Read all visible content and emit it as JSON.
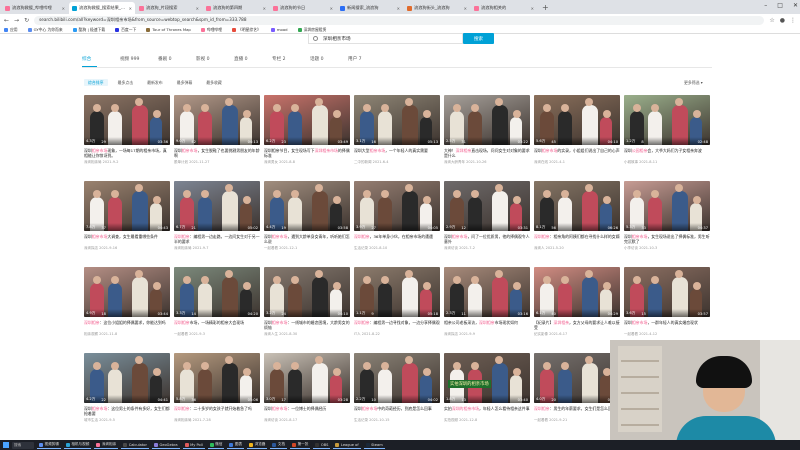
{
  "browser": {
    "tabs": [
      {
        "label": "流浪狗救援_哔哩哔哩",
        "color": "#fb7299",
        "active": false
      },
      {
        "label": "流浪狗救援_搜索结果_哔哩哔哩",
        "color": "#00a1d6",
        "active": true
      },
      {
        "label": "流浪狗_片段搜索",
        "color": "#fb7299",
        "active": false
      },
      {
        "label": "流浪狗的第四期",
        "color": "#fb7299",
        "active": false
      },
      {
        "label": "流浪狗的节日",
        "color": "#fb7299",
        "active": false
      },
      {
        "label": "新闻搜索_流浪狗",
        "color": "#2b6ef5",
        "active": false
      },
      {
        "label": "流浪狗街头_流浪狗",
        "color": "#e06b2d",
        "active": false
      },
      {
        "label": "流浪狗相关的",
        "color": "#fb7299",
        "active": false
      }
    ],
    "url": "search.bilibili.com/all?keyword=深圳相亲市场&from_source=webtop_search&spm_id_from=333.788",
    "bookmarks": [
      {
        "label": "应用",
        "color": "#4285f4"
      },
      {
        "label": "GY中心 为你而来",
        "color": "#5b8def"
      },
      {
        "label": "酷狗 | 极速下载",
        "color": "#2b9bf4"
      },
      {
        "label": "百度一下",
        "color": "#2932e1"
      },
      {
        "label": "Tour of Thrones Map",
        "color": "#8a6d3b"
      },
      {
        "label": "哔哩哔哩",
        "color": "#fb7299"
      },
      {
        "label": "《明星综艺》",
        "color": "#e74c3c"
      },
      {
        "label": "mood",
        "color": "#7a5cff"
      },
      {
        "label": "深圳房屋租赁",
        "color": "#34a853"
      }
    ]
  },
  "search": {
    "query": "深圳相亲市场",
    "button": "搜索"
  },
  "categories": [
    {
      "label": "综合",
      "active": true
    },
    {
      "label": "视频 999",
      "active": false
    },
    {
      "label": "番剧 0",
      "active": false
    },
    {
      "label": "影视 0",
      "active": false
    },
    {
      "label": "直播 0",
      "active": false
    },
    {
      "label": "专栏 2",
      "active": false
    },
    {
      "label": "话题 0",
      "active": false
    },
    {
      "label": "用户 7",
      "active": false
    }
  ],
  "filters": [
    {
      "label": "综合排序",
      "active": true
    },
    {
      "label": "最多点击",
      "active": false
    },
    {
      "label": "最新发布",
      "active": false
    },
    {
      "label": "最多弹幕",
      "active": false
    },
    {
      "label": "最多收藏",
      "active": false
    }
  ],
  "all_filters": "更多筛选",
  "videos": [
    {
      "plays": "4.3万",
      "danmaku": "29",
      "duration": "03:36",
      "title_pre": "深圳",
      "title_hl": "相亲市场",
      "title_post": "现象，一场每17期的相亲市场，真相能让你惊讶到。",
      "author": "深圳相亲局",
      "date": "2021-9-2",
      "bg": "#8c7464"
    },
    {
      "plays": "9.0万",
      "danmaku": "42",
      "duration": "04:13",
      "title_pre": "深圳",
      "title_hl": "相亲市场",
      "title_post": "，女生脱鞋了也要挑剔男朋友的年龄啊",
      "author": "脱单计划",
      "date": "2021-11-27",
      "bg": "#b49a8a"
    },
    {
      "plays": "6.2万",
      "danmaku": "23",
      "duration": "03:49",
      "title_pre": "深圳相亲节目，女生现场写下",
      "title_hl": "深圳相亲市场",
      "title_post": "的择偶标准",
      "author": "深圳男女",
      "date": "2021-8-8",
      "bg": "#c9736b"
    },
    {
      "plays": "3.1万",
      "danmaku": "16",
      "duration": "05:13",
      "title_pre": "深圳大型",
      "title_hl": "相亲市场",
      "title_post": "，一个年轻人的真实需要",
      "author": "二中的新闻",
      "date": "2021-6-4",
      "bg": "#8f8676"
    },
    {
      "plays": "2.5万",
      "danmaku": "31",
      "duration": "03:22",
      "title_pre": "大神！",
      "title_hl": "深圳相亲",
      "title_post": "直击现场，问问女生对对象的要求是什么",
      "author": "深圳大龄青年",
      "date": "2021-10-26",
      "bg": "#a7a19b"
    },
    {
      "plays": "5.6万",
      "danmaku": "45",
      "duration": "04:10",
      "title_pre": "深圳",
      "title_hl": "相亲市场",
      "title_post": "的实录，小姐姐们说出了自己的心声",
      "author": "深圳在线",
      "date": "2021-4-1",
      "bg": "#8a6f5b"
    },
    {
      "plays": "1.2万",
      "danmaku": "8",
      "duration": "02:48",
      "title_pre": "深圳",
      "title_hl": "公园相亲",
      "title_post": "会，大爷大妈们为子女相亲奔波",
      "author": "小城故事",
      "date": "2021-8-11",
      "bg": "#9bb08c"
    },
    {
      "plays": "7.8万",
      "danmaku": "37",
      "duration": "04:43",
      "title_pre": "深圳",
      "title_hl": "相亲市场",
      "title_post": "大调查，女生最看重哪些条件",
      "author": "深圳探店",
      "date": "2021-9-16",
      "bg": "#9a826f"
    },
    {
      "plays": "6.7万",
      "danmaku": "21",
      "duration": "05:02",
      "title_pre": "",
      "title_hl": "深圳相亲",
      "title_post": "：编程男一边走路，一边问女生对于另一半的要求",
      "author": "深圳相亲局",
      "date": "2021-9-7",
      "bg": "#7d8593"
    },
    {
      "plays": "4.4万",
      "danmaku": "19",
      "duration": "03:58",
      "title_pre": "深圳",
      "title_hl": "相亲市场",
      "title_post": "，遇到大龄单身女青年，听听她们怎么说",
      "author": "一起看看",
      "date": "2021-12-1",
      "bg": "#a18e7f"
    },
    {
      "plays": "3.9万",
      "danmaku": "27",
      "duration": "04:05",
      "title_pre": "",
      "title_hl": "深圳相亲",
      "title_post": "，36年单身小伙，在相亲市场的遭遇",
      "author": "生活记录",
      "date": "2021-8-10",
      "bg": "#957e72"
    },
    {
      "plays": "2.9万",
      "danmaku": "12",
      "duration": "03:31",
      "title_pre": "深圳",
      "title_hl": "相亲市场",
      "title_post": "，问了一位优质男，他的择偶观令人意外",
      "author": "深圳访谈",
      "date": "2021-7-2",
      "bg": "#6e6a6a"
    },
    {
      "plays": "8.1万",
      "danmaku": "56",
      "duration": "06:26",
      "title_pre": "",
      "title_hl": "深圳相亲",
      "title_post": "：相亲角的阿姨们都在寻找什么样的女婿",
      "author": "深圳人",
      "date": "2021-5-20",
      "bg": "#857565"
    },
    {
      "plays": "5.3万",
      "danmaku": "33",
      "duration": "04:37",
      "title_pre": "深圳",
      "title_hl": "相亲市场",
      "title_post": "，女生现场说出了择偶标准，男生听完沉默了",
      "author": "小李访谈",
      "date": "2021-10-3",
      "bg": "#c79c94"
    },
    {
      "plays": "4.9万",
      "danmaku": "18",
      "duration": "03:44",
      "title_pre": "",
      "title_hl": "深圳相亲",
      "title_post": "：这位小姐姐的择偶要求，你能达到吗",
      "author": "相亲观察",
      "date": "2021-11-8",
      "bg": "#b58f85"
    },
    {
      "plays": "3.3万",
      "danmaku": "14",
      "duration": "04:20",
      "title_pre": "",
      "title_hl": "深圳相亲",
      "title_post": "市场，一场精彩的相亲大会现场",
      "author": "一起看看",
      "date": "2021-9-3",
      "bg": "#7c8a7c"
    },
    {
      "plays": "3.2万",
      "danmaku": "24",
      "duration": "04:10",
      "title_pre": "深圳",
      "title_hl": "相亲市场",
      "title_post": "：一线城市的婚恋困境，大龄男女的烦恼",
      "author": "深圳人生",
      "date": "2021-8-30",
      "bg": "#867a70"
    },
    {
      "plays": "1.1万",
      "danmaku": "9",
      "duration": "05:18",
      "title_pre": "",
      "title_hl": "深圳相亲",
      "title_post": "：编程男一边寻找对象，一边分享择偶观",
      "author": "IT人",
      "date": "2021-8-22",
      "bg": "#8d7c6d"
    },
    {
      "plays": "2.3万",
      "danmaku": "11",
      "duration": "03:16",
      "title_pre": "相亲公司老板采访，",
      "title_hl": "深圳相亲",
      "title_post": "市场现状如何",
      "author": "深圳探店",
      "date": "2021-9-9",
      "bg": "#a88b7b"
    },
    {
      "plays": "6.1万",
      "danmaku": "40",
      "duration": "04:29",
      "title_pre": "【纪录片】",
      "title_hl": "深圳相亲",
      "title_post": "，女方父母的要求让人难以接受",
      "author": "纪实影像",
      "date": "2021-6-17",
      "bg": "#d28d83"
    },
    {
      "plays": "3.6万",
      "danmaku": "15",
      "duration": "03:57",
      "title_pre": "深圳",
      "title_hl": "相亲市场",
      "title_post": "，一群年轻人的真实婚恋现状",
      "author": "一起看看",
      "date": "2021-4-12",
      "bg": "#8c6f62"
    },
    {
      "plays": "4.2万",
      "danmaku": "22",
      "duration": "04:41",
      "title_pre": "深圳",
      "title_hl": "相亲市场",
      "title_post": "：这位男士的条件有多好，女生们都抢着要",
      "author": "城市生活",
      "date": "2021-9-5",
      "bg": "#7a8f9b"
    },
    {
      "plays": "5.8万",
      "danmaku": "36",
      "duration": "05:06",
      "title_pre": "",
      "title_hl": "深圳相亲",
      "title_post": "：二十多岁的女孩子就开始着急了吗",
      "author": "深圳相亲局",
      "date": "2021-7-28",
      "bg": "#b59a7f"
    },
    {
      "plays": "3.0万",
      "danmaku": "17",
      "duration": "03:28",
      "title_pre": "深圳",
      "title_hl": "相亲市场",
      "title_post": "：一位博士的择偶经历",
      "author": "深圳访谈",
      "date": "2021-8-17",
      "bg": "#c9c1b6"
    },
    {
      "plays": "2.2万",
      "danmaku": "10",
      "duration": "04:02",
      "title_pre": "深圳",
      "title_hl": "相亲市场",
      "title_post": "中的奇葩经历，到底是怎么回事",
      "author": "生活记录",
      "date": "2021-10-15",
      "bg": "#8b8377"
    },
    {
      "plays": "1.8万",
      "danmaku": "13",
      "duration": "03:40",
      "title_pre": "实拍",
      "title_hl": "深圳的相亲市场",
      "title_post": "，年轻人怎么看待相亲这件事",
      "author": "实拍视频",
      "date": "2021-12-8",
      "bg": "#6d5e54",
      "caption": "实拍深圳的相亲市场"
    },
    {
      "plays": "4.0万",
      "danmaku": "20",
      "duration": "04:30",
      "title_pre": "",
      "title_hl": "深圳相亲",
      "title_post": "：男生的年薪要求，女生们是怎么回答的",
      "author": "一起看看",
      "date": "2021-9-21",
      "bg": "#75706d"
    },
    {
      "plays": "5.0万",
      "danmaku": "29",
      "duration": "04:18",
      "title_pre": "深圳",
      "title_hl": "相亲市场",
      "title_post": "直击：择偶标准越来越高了吗",
      "author": "深圳在线",
      "date": "2021-11-2",
      "bg": "#99867a"
    },
    {
      "plays": "3.4万",
      "danmaku": "19",
      "duration": "03:52",
      "title_pre": "",
      "title_hl": "深圳相亲",
      "title_post": "：这位阿姨为了给女儿找对象操碎了心",
      "author": "城市记录",
      "date": "2021-8-28",
      "bg": "#a08a7e"
    },
    {
      "plays": "2.6万",
      "danmaku": "16",
      "duration": "04:08",
      "title_pre": "深圳",
      "title_hl": "相亲市场",
      "title_post": "，女方父母的要求，男生们怎么看",
      "author": "深圳人生",
      "date": "2021-9-12",
      "bg": "#7f7b86"
    }
  ],
  "taskbar": {
    "search_label": "搜索",
    "apps": [
      {
        "label": "视频剪辑",
        "color": "#5b8def"
      },
      {
        "label": "相机与视频",
        "color": "#29a3d6"
      },
      {
        "label": "深圳相亲",
        "color": "#fb7299"
      },
      {
        "label": "Calculator",
        "color": "#4a4a4a"
      },
      {
        "label": "GeoGebra",
        "color": "#8a7dd8"
      },
      {
        "label": "My Poll",
        "color": "#e05b5b"
      },
      {
        "label": "微信",
        "color": "#2ebd5c"
      },
      {
        "label": "图表",
        "color": "#3c78d8"
      },
      {
        "label": "浏览器",
        "color": "#f0b41c"
      },
      {
        "label": "文档",
        "color": "#2b579a"
      },
      {
        "label": "第一张",
        "color": "#d24726"
      },
      {
        "label": "OBS",
        "color": "#333"
      },
      {
        "label": "League of",
        "color": "#c89b3c"
      },
      {
        "label": "Steam",
        "color": "#1b2838"
      }
    ]
  }
}
